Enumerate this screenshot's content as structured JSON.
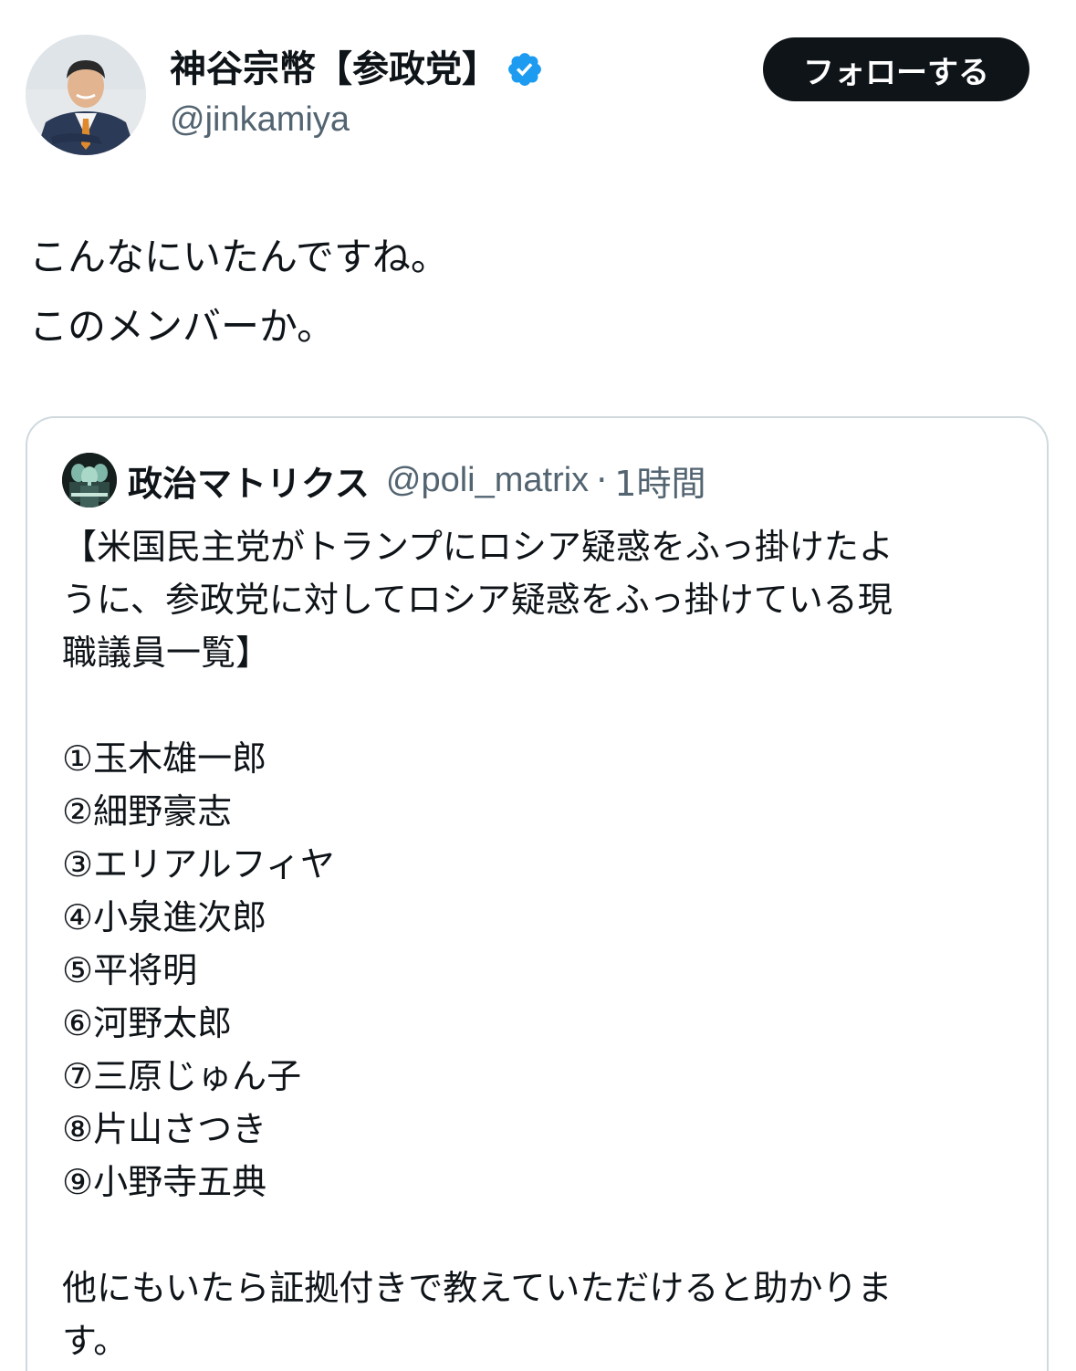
{
  "author": {
    "name": "神谷宗幣【参政党】",
    "handle": "@jinkamiya",
    "avatar_icon": "profile-photo",
    "verified_icon": "verified-badge-icon",
    "verified_color": "#1d9bf0"
  },
  "follow_button": {
    "label": "フォローする"
  },
  "tweet": {
    "lines": [
      "こんなにいたんですね。",
      "このメンバーか。"
    ]
  },
  "quote": {
    "name": "政治マトリクス",
    "handle": "@poli_matrix",
    "separator": "·",
    "time": "1時間",
    "heading_lines": [
      "【米国民主党がトランプにロシア疑惑をふっ掛けたよ",
      "うに、参政党に対してロシア疑惑をふっ掛けている現",
      "職議員一覧】"
    ],
    "members": [
      "①玉木雄一郎",
      "②細野豪志",
      "③エリアルフィヤ",
      "④小泉進次郎",
      "⑤平将明",
      "⑥河野太郎",
      "⑦三原じゅん子",
      "⑧片山さつき",
      "⑨小野寺五典"
    ],
    "closing_lines": [
      "他にもいたら証拠付きで教えていただけると助かりま",
      "す。"
    ]
  }
}
